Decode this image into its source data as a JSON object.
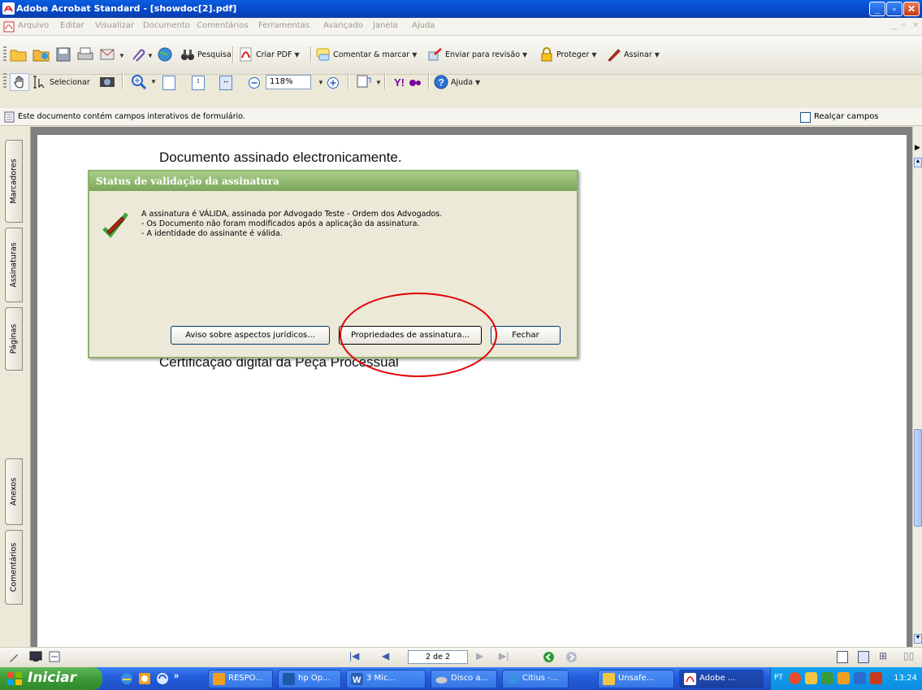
{
  "window": {
    "title": "Adobe Acrobat Standard - [showdoc[2].pdf]"
  },
  "menu": {
    "items": [
      "Arquivo",
      "Editar",
      "Visualizar",
      "Documento",
      "Comentários",
      "Ferramentas",
      "Avançado",
      "Janela",
      "Ajuda"
    ]
  },
  "toolbar": {
    "search_label": "Pesquisa",
    "create_pdf_label": "Criar PDF",
    "comment_label": "Comentar & marcar",
    "review_label": "Enviar para revisão",
    "protect_label": "Proteger",
    "sign_label": "Assinar",
    "select_label": "Selecionar",
    "zoom_value": "118%",
    "help_label": "Ajuda"
  },
  "infobar": {
    "message": "Este documento contém campos interativos de formulário.",
    "highlight_label": "Realçar campos"
  },
  "navpanel": {
    "tabs": [
      "Marcadores",
      "Assinaturas",
      "Páginas",
      "Anexos",
      "Comentários"
    ]
  },
  "document": {
    "line1": "Documento assinado electronicamente.",
    "line2": "Certificação digital da Peça Processual"
  },
  "dialog": {
    "title": "Status de validação da assinatura",
    "message_lines": [
      "A assinatura é VÁLIDA, assinada por Advogado Teste - Ordem dos Advogados.",
      "- Os Documento não foram modificados após a aplicação da assinatura.",
      "- A identidade do assinante é válida."
    ],
    "buttons": {
      "legal": "Aviso sobre aspectos jurídicos...",
      "properties": "Propriedades de assinatura...",
      "close": "Fechar"
    },
    "annotation_color": "#e00000"
  },
  "statusbar": {
    "page_indicator": "2 de 2"
  },
  "taskbar": {
    "start_label": "Iniciar",
    "overflow_label": "»",
    "buttons": [
      "RESPO...",
      "hp Op...",
      "3 Mic...",
      "Disco a...",
      "Citius -...",
      "Unsafe...",
      "Adobe ..."
    ],
    "language": "PT",
    "clock": "13:24"
  },
  "colors": {
    "titlebar": "#0a5ee0",
    "dialog_title": "#7ba65a",
    "taskbar": "#245edb",
    "start": "#3c9a36"
  }
}
